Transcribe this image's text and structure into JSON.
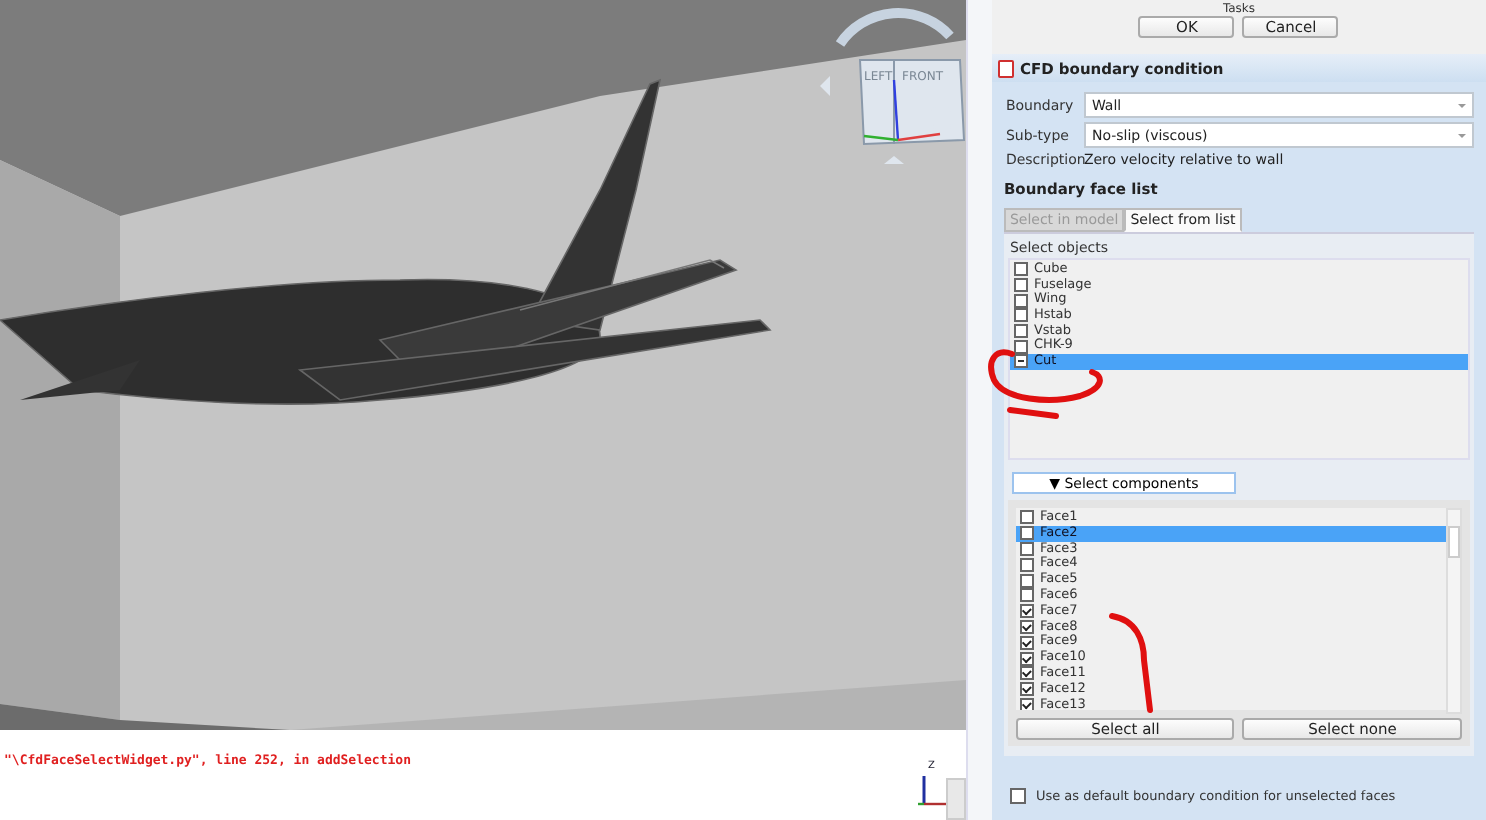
{
  "viewport": {
    "nav_cube_faces": [
      "LEFT",
      "FRONT"
    ],
    "axis_label": "Z",
    "console_lines": [
      "\"\\CfdFaceSelectWidget.py\", line 252, in addSelection"
    ]
  },
  "tasks": {
    "title": "Tasks",
    "buttons": [
      "OK",
      "Cancel"
    ]
  },
  "panel": {
    "title": "CFD boundary condition",
    "fields": [
      {
        "label": "Boundary",
        "value": "Wall"
      },
      {
        "label": "Sub-type",
        "value": "No-slip (viscous)"
      }
    ],
    "description": {
      "label": "Description",
      "value": "Zero velocity relative to wall"
    },
    "section_title": "Boundary face list",
    "tabs": [
      {
        "label": "Select in model",
        "selected": false
      },
      {
        "label": "Select from list",
        "selected": true
      }
    ],
    "objects_label": "Select objects",
    "objects": [
      {
        "label": "Cube",
        "checked": false,
        "partial": false,
        "selected": false
      },
      {
        "label": "Fuselage",
        "checked": false,
        "partial": false,
        "selected": false
      },
      {
        "label": "Wing",
        "checked": false,
        "partial": false,
        "selected": false
      },
      {
        "label": "Hstab",
        "checked": false,
        "partial": false,
        "selected": false
      },
      {
        "label": "Vstab",
        "checked": false,
        "partial": false,
        "selected": false
      },
      {
        "label": "CHK-9",
        "checked": false,
        "partial": false,
        "selected": false
      },
      {
        "label": "Cut",
        "checked": true,
        "partial": true,
        "selected": true
      }
    ],
    "components_button": "▼ Select components",
    "faces": [
      {
        "label": "Face1",
        "checked": false,
        "selected": false
      },
      {
        "label": "Face2",
        "checked": false,
        "selected": true
      },
      {
        "label": "Face3",
        "checked": false,
        "selected": false
      },
      {
        "label": "Face4",
        "checked": false,
        "selected": false
      },
      {
        "label": "Face5",
        "checked": false,
        "selected": false
      },
      {
        "label": "Face6",
        "checked": false,
        "selected": false
      },
      {
        "label": "Face7",
        "checked": true,
        "selected": false
      },
      {
        "label": "Face8",
        "checked": true,
        "selected": false
      },
      {
        "label": "Face9",
        "checked": true,
        "selected": false
      },
      {
        "label": "Face10",
        "checked": true,
        "selected": false
      },
      {
        "label": "Face11",
        "checked": true,
        "selected": false
      },
      {
        "label": "Face12",
        "checked": true,
        "selected": false
      },
      {
        "label": "Face13",
        "checked": true,
        "selected": false
      }
    ],
    "face_buttons": [
      "Select all",
      "Select none"
    ],
    "default_option": {
      "label": "Use as default boundary condition for unselected faces",
      "checked": false
    }
  }
}
